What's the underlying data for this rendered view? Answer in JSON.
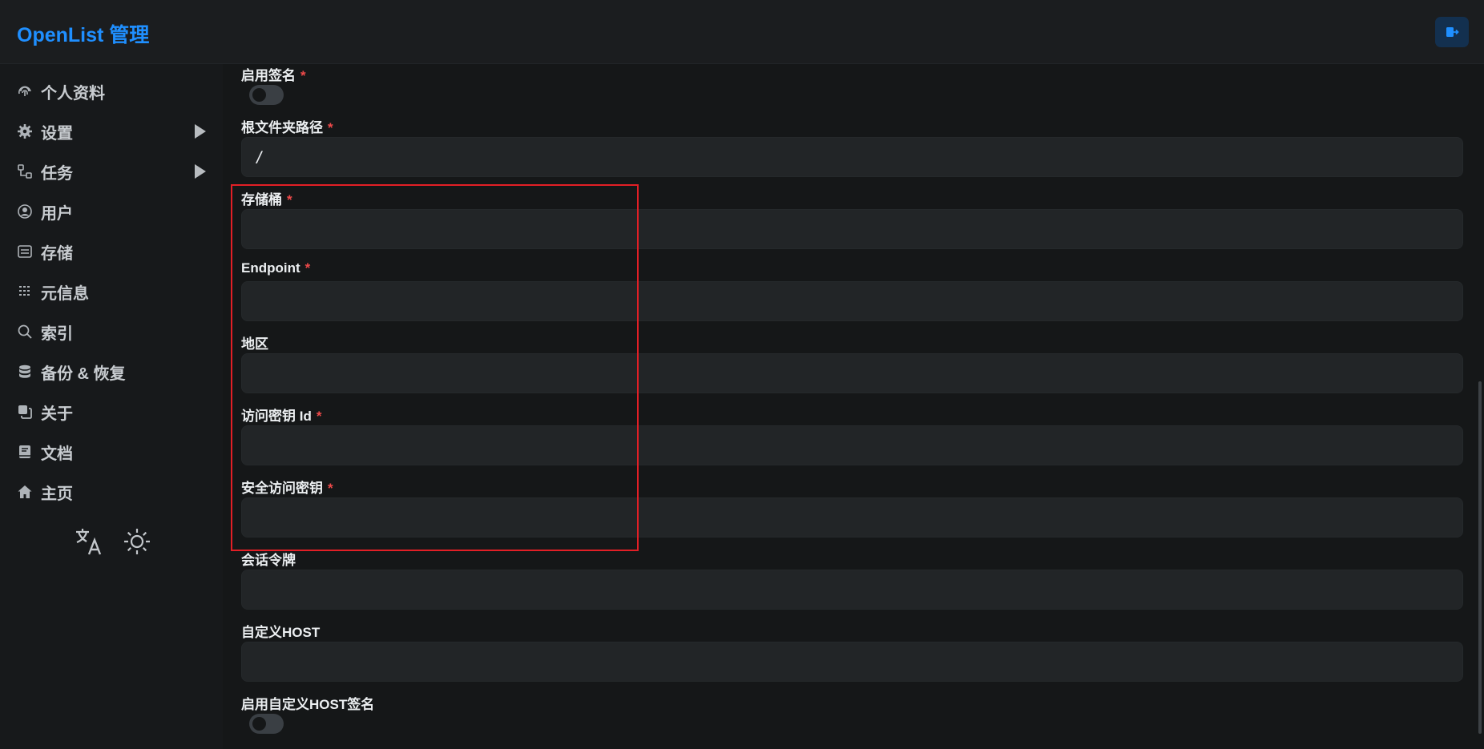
{
  "header": {
    "title": "OpenList 管理"
  },
  "sidebar": {
    "items": [
      {
        "label": "个人资料",
        "icon": "fingerprint-icon"
      },
      {
        "label": "设置",
        "icon": "gear-icon"
      },
      {
        "label": "任务",
        "icon": "workflow-icon"
      },
      {
        "label": "用户",
        "icon": "user-circle-icon"
      },
      {
        "label": "存储",
        "icon": "storage-icon"
      },
      {
        "label": "元信息",
        "icon": "grid-icon"
      },
      {
        "label": "索引",
        "icon": "search-icon"
      },
      {
        "label": "备份 & 恢复",
        "icon": "database-icon"
      },
      {
        "label": "关于",
        "icon": "copy-icon"
      },
      {
        "label": "文档",
        "icon": "book-icon"
      },
      {
        "label": "主页",
        "icon": "home-icon"
      }
    ]
  },
  "form": {
    "enable_sign": {
      "label": "启用签名",
      "required": "*",
      "checked": false
    },
    "root_folder": {
      "label": "根文件夹路径",
      "required": "*",
      "value": "/"
    },
    "bucket": {
      "label": "存储桶",
      "required": "*",
      "value": ""
    },
    "endpoint": {
      "label": "Endpoint",
      "required": "*",
      "value": ""
    },
    "region": {
      "label": "地区",
      "value": ""
    },
    "access_key_id": {
      "label": "访问密钥 Id",
      "required": "*",
      "value": ""
    },
    "secret_access_key": {
      "label": "安全访问密钥",
      "required": "*",
      "value": ""
    },
    "session_token": {
      "label": "会话令牌",
      "value": ""
    },
    "custom_host": {
      "label": "自定义HOST",
      "value": ""
    },
    "enable_custom_host_sign": {
      "label": "启用自定义HOST签名",
      "checked": false
    }
  },
  "colors": {
    "accent": "#1f8fff",
    "required": "#ef4a4a",
    "highlight_box": "#e21f26"
  }
}
